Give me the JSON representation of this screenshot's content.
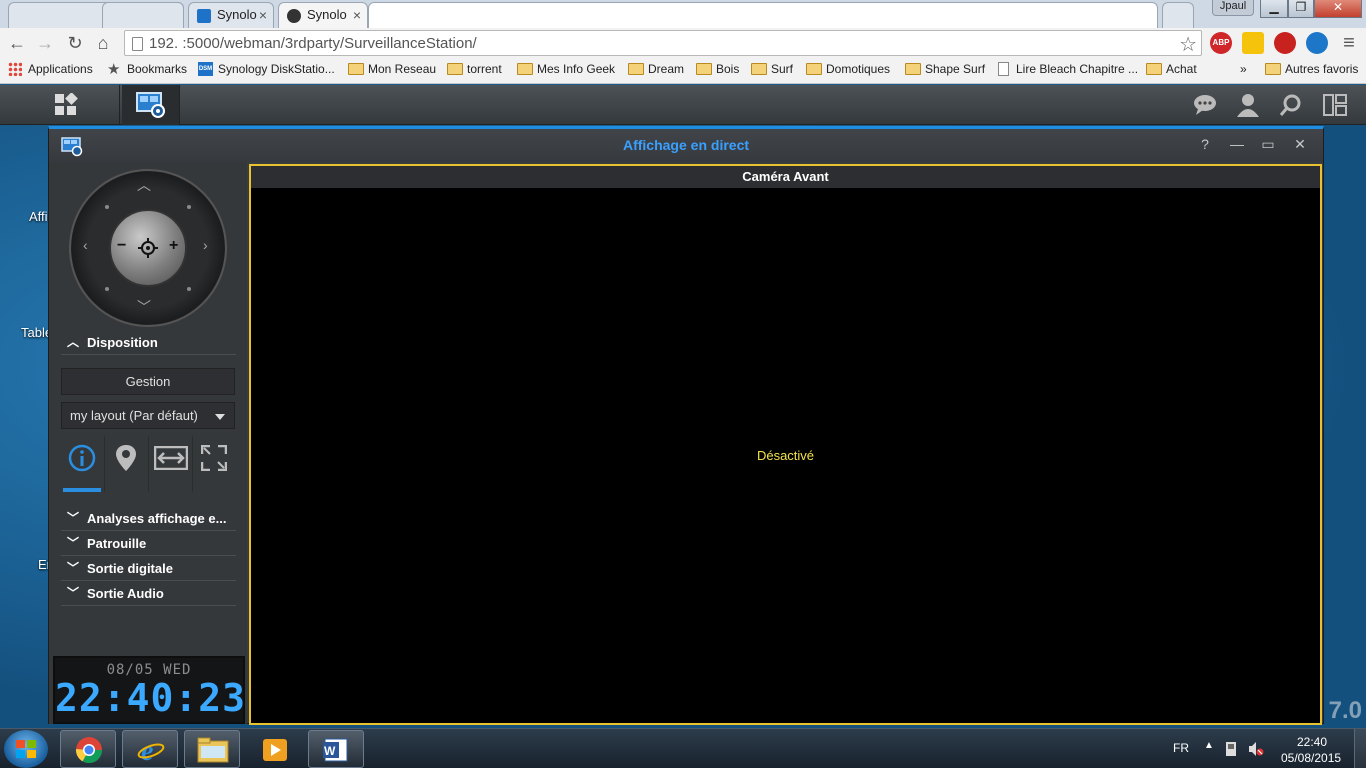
{
  "browser": {
    "tabs": [
      {
        "label": "",
        "active": false
      },
      {
        "label": "",
        "active": false
      },
      {
        "label": "Synolo",
        "active": false
      },
      {
        "label": "Synolo",
        "active": true
      },
      {
        "label": "",
        "active": false
      }
    ],
    "user_badge": "Jpaul",
    "url": "192.            :5000/webman/3rdparty/SurveillanceStation/",
    "extensions": {
      "abp": "ABP"
    },
    "bookmarks": {
      "apps": "Applications",
      "bookmarks": "Bookmarks",
      "synology": "Synology DiskStatio...",
      "mon_reseau": "Mon Reseau",
      "torrent": "torrent",
      "mes_info_geek": "Mes Info Geek",
      "dream": "Dream",
      "bois": "Bois",
      "surf": "Surf",
      "domotiques": "Domotiques",
      "shape_surf": "Shape Surf",
      "lire_bleach": "Lire Bleach Chapitre ...",
      "achat": "Achat",
      "more": "»",
      "autres": "Autres favoris"
    }
  },
  "desktop": {
    "labels": {
      "l1": "Affi",
      "l2": "Table",
      "l3": "Er"
    },
    "version": "7.0"
  },
  "surveillance": {
    "title": "Affichage en direct",
    "window_controls": {
      "help": "?",
      "minimize": "—",
      "maximize": "▭",
      "close": "✕"
    },
    "sidebar": {
      "disposition": "Disposition",
      "gestion": "Gestion",
      "layout": "my layout (Par défaut)",
      "sections": {
        "analyses": "Analyses affichage e...",
        "patrouille": "Patrouille",
        "sortie_digitale": "Sortie digitale",
        "sortie_audio": "Sortie Audio"
      }
    },
    "clock": {
      "date": "08/05 WED",
      "time": "22:40:23"
    },
    "camera": {
      "name": "Caméra Avant",
      "status": "Désactivé"
    }
  },
  "taskbar": {
    "lang": "FR",
    "time": "22:40",
    "date": "05/08/2015"
  },
  "colors": {
    "accent": "#3aa0ff",
    "camera_border": "#e8c230",
    "status_text": "#f2e14c"
  }
}
